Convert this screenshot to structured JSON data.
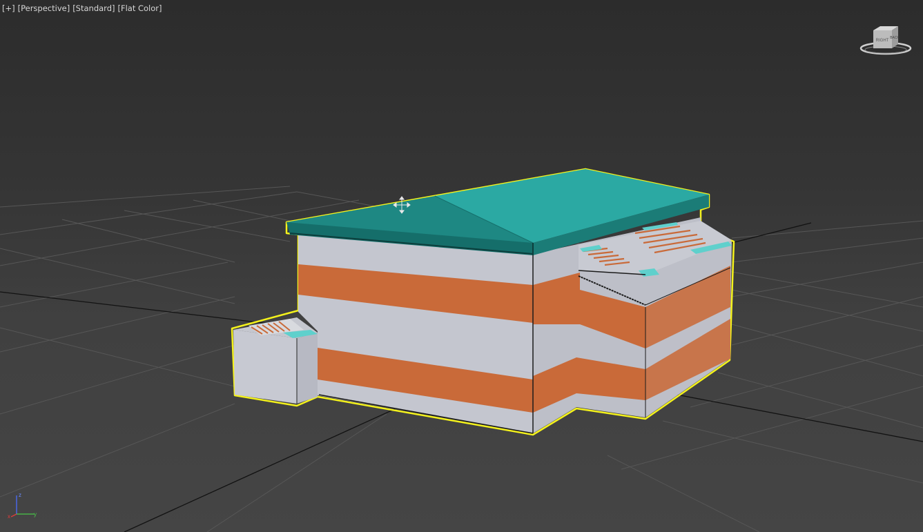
{
  "viewport": {
    "menu_plus": "[+]",
    "view_label": "[Perspective]",
    "shading_label": "[Standard]",
    "style_label": "[Flat Color]"
  },
  "viewcube": {
    "face_left": "RIGHT",
    "face_right": "BACK",
    "icon": "viewcube-icon"
  },
  "axis_tripod": {
    "x": "x",
    "y": "y",
    "z": "z"
  },
  "colors": {
    "roof_light": "#2ba9a3",
    "roof_dark": "#1e8883",
    "wall": "#c4c6cf",
    "stripe": "#c96a39",
    "selection": "#f4f21c",
    "grid": "#5a5a5a",
    "grid_main": "#111111"
  }
}
